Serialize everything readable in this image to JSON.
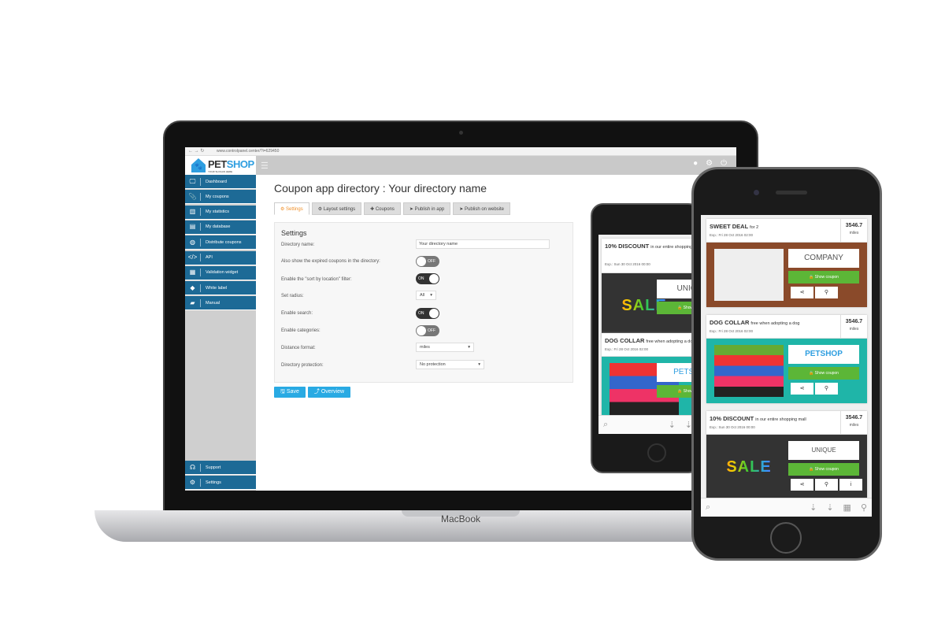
{
  "laptop": {
    "brand": "MacBook"
  },
  "browser": {
    "url": "www.controlpanel.center/?i=629450"
  },
  "app": {
    "logo": {
      "pet": "PET",
      "shop": "SHOP",
      "slogan": "YOUR SLOGAN HERE"
    },
    "sidebar": {
      "items": [
        {
          "label": "Dashboard",
          "icon": "monitor-icon",
          "glyph": "🖵"
        },
        {
          "label": "My coupons",
          "icon": "paperclip-icon",
          "glyph": "📎"
        },
        {
          "label": "My statistics",
          "icon": "bar-chart-icon",
          "glyph": "▥"
        },
        {
          "label": "My database",
          "icon": "database-icon",
          "glyph": "▤"
        },
        {
          "label": "Distribute coupons",
          "icon": "globe-icon",
          "glyph": "◍"
        },
        {
          "label": "API",
          "icon": "code-icon",
          "glyph": "</>"
        },
        {
          "label": "Validation widget",
          "icon": "barcode-icon",
          "glyph": "▦"
        },
        {
          "label": "White label",
          "icon": "tag-icon",
          "glyph": "◆"
        },
        {
          "label": "Manual",
          "icon": "book-icon",
          "glyph": "▰"
        }
      ],
      "bottom": [
        {
          "label": "Support",
          "icon": "headset-icon",
          "glyph": "☊"
        },
        {
          "label": "Settings",
          "icon": "gear-icon",
          "glyph": "⚙"
        }
      ]
    },
    "page_title": "Coupon app directory : Your directory name",
    "tabs": [
      "Settings",
      "Layout settings",
      "Coupons",
      "Publish in app",
      "Publish on website"
    ],
    "settings": {
      "heading": "Settings",
      "directory_name_label": "Directory name:",
      "directory_name_value": "Your directory name",
      "expired_label": "Also show the expired coupons in the directory:",
      "expired": "OFF",
      "sort_label": "Enable the \"sort by location\" filter:",
      "sort": "ON",
      "radius_label": "Set radius:",
      "radius": "All",
      "search_label": "Enable search:",
      "search": "ON",
      "categories_label": "Enable categories:",
      "categories": "OFF",
      "distance_label": "Distance format:",
      "distance": "miles",
      "protection_label": "Directory protection:",
      "protection": "No protection"
    },
    "buttons": {
      "save": "Save",
      "overview": "Overview"
    }
  },
  "coupons": [
    {
      "title": "SWEET DEAL",
      "sub": "for 2",
      "exp": "Exp.: Fri 28 Oct 2016 02:00",
      "dist": "3546.7",
      "unit": "miles",
      "brand": "COMPANY",
      "show": "🔒 Show coupon"
    },
    {
      "title": "DOG COLLAR",
      "sub": "free when adopting a dog",
      "exp": "Exp.: Fri 28 Oct 2016 02:00",
      "dist": "3546.7",
      "unit": "miles",
      "brand": "PETSHOP",
      "show": "🔒 Show coupon"
    },
    {
      "title": "10% DISCOUNT",
      "sub": "in our entire shopping mall",
      "exp": "Exp.: Sun 30 Oct 2016 00:00",
      "dist": "3546.7",
      "unit": "miles",
      "brand": "UNIQUE",
      "show": "🔒 Show coupon",
      "sale": "SALE"
    }
  ]
}
